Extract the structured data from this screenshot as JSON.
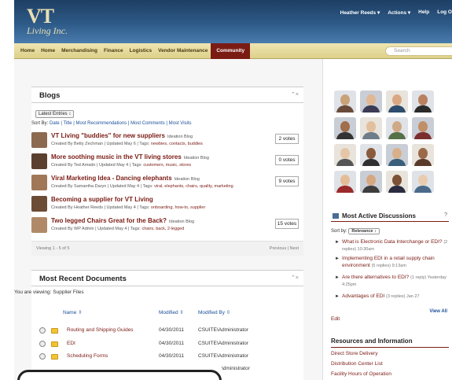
{
  "header": {
    "logo_main": "VT",
    "logo_sub": "Living Inc.",
    "user": "Heather Reeds ▾",
    "actions": "Actions ▾",
    "help": "Help",
    "logout": "Log O"
  },
  "nav": {
    "items": [
      "Home",
      "Home",
      "Merchandising",
      "Finance",
      "Logistics",
      "Vendor Maintenance",
      "Community"
    ],
    "active_index": 6,
    "search_placeholder": "Search"
  },
  "blogs": {
    "title": "Blogs",
    "close": "⌃×",
    "select_label": "Latest Entries ↕",
    "sort_prefix": "Sort By:",
    "sort_links": "Date | Title | Most Recommendations | Most Comments | Most Visits",
    "entries": [
      {
        "title": "VT Living \"buddies\" for new suppliers",
        "type": "Ideation Blog",
        "meta": "Created By Betty Zechman  |  Updated May 6  |  Tags:",
        "tags": "newbies, contacts, buddies",
        "votes": "2 votes"
      },
      {
        "title": "More soothing music in the VT living stores",
        "type": "Ideation Blog",
        "meta": "Created By Ted Amado  |  Updated May 4  |  Tags:",
        "tags": "customers, music, stores",
        "votes": "0 votes"
      },
      {
        "title": "Viral Marketing Idea - Dancing elephants",
        "type": "Ideation Blog",
        "meta": "Created By Samantha Daryn  |  Updated May 4  |  Tags:",
        "tags": "viral, elephants, chairs, quality, marketing",
        "votes": "9 votes"
      },
      {
        "title": "Becoming a supplier for VT Living",
        "type": "",
        "meta": "Created By Heather Reeds  |  Updated May 4  |  Tags:",
        "tags": "onboarding, how-to, supplier",
        "votes": ""
      },
      {
        "title": "Two legged Chairs Great for the Back?",
        "type": "Ideation Blog",
        "meta": "Created By WP Admin  |  Updated May 4  |  Tags:",
        "tags": "chairs, back, 2-legged",
        "votes": "15 votes"
      }
    ],
    "pager_count": "Viewing 1 - 5 of 5",
    "pager_nav": "Previous | Next"
  },
  "documents": {
    "title": "Most Recent Documents",
    "close": "⌃×",
    "viewing": "You are viewing: Supplier Files",
    "col_name": "Name ⇳",
    "col_modified": "Modified ⇳",
    "col_modified_by": "Modified By ⇳",
    "rows": [
      {
        "name": "Routing and Shipping Guides",
        "modified": "04/30/2011",
        "by": "CSUITE\\Administrator"
      },
      {
        "name": "EDI",
        "modified": "04/30/2011",
        "by": "CSUITE\\Administrator"
      },
      {
        "name": "Scheduling Forms",
        "modified": "04/30/2011",
        "by": "CSUITE\\Administrator"
      }
    ],
    "partial": "\\dministrator"
  },
  "discussions": {
    "title": "Most Active Discussions",
    "help": "?",
    "sort_prefix": "Sort by:",
    "sort_value": "Relevance ↕",
    "items": [
      {
        "title": "What is Electronic Data Interchange or EDI?",
        "meta": "(2 replies) 10:30am"
      },
      {
        "title": "Implementing EDI in a retail supply chain environment",
        "meta": "(5 replies) 9:13am"
      },
      {
        "title": "Are there alternatives to EDI?",
        "meta": "(1 reply) Yesterday 4:25pm"
      },
      {
        "title": "Advantages of EDI",
        "meta": "(3 replies) Jan 27"
      }
    ],
    "edit": "Edit",
    "view_all": "View All"
  },
  "resources": {
    "title": "Resources and Information",
    "items": [
      "Direct Store Delivery",
      "Distribution Center List",
      "Facility Hours of Operation"
    ]
  },
  "face_colors": [
    [
      "#c9a27a",
      "#6a4b3a"
    ],
    [
      "#e0b894",
      "#3b3b55"
    ],
    [
      "#d9a883",
      "#2e4c6d"
    ],
    [
      "#b98160",
      "#2b2b2b"
    ],
    [
      "#a06e4a",
      "#333333"
    ],
    [
      "#e2bf9d",
      "#6d7d8a"
    ],
    [
      "#d0aa86",
      "#567048"
    ],
    [
      "#c08f67",
      "#7a2e2e"
    ],
    [
      "#e6c6a8",
      "#555555"
    ],
    [
      "#8a5a3c",
      "#303030"
    ],
    [
      "#d8b08a",
      "#3a5f7a"
    ],
    [
      "#9c6a48",
      "#5a3a2a"
    ],
    [
      "#e4bd98",
      "#9b2a2a"
    ],
    [
      "#d6a882",
      "#3d3d3d"
    ],
    [
      "#7e5034",
      "#2c2c40"
    ],
    [
      "#e9ccb0",
      "#4b6a8a"
    ]
  ]
}
